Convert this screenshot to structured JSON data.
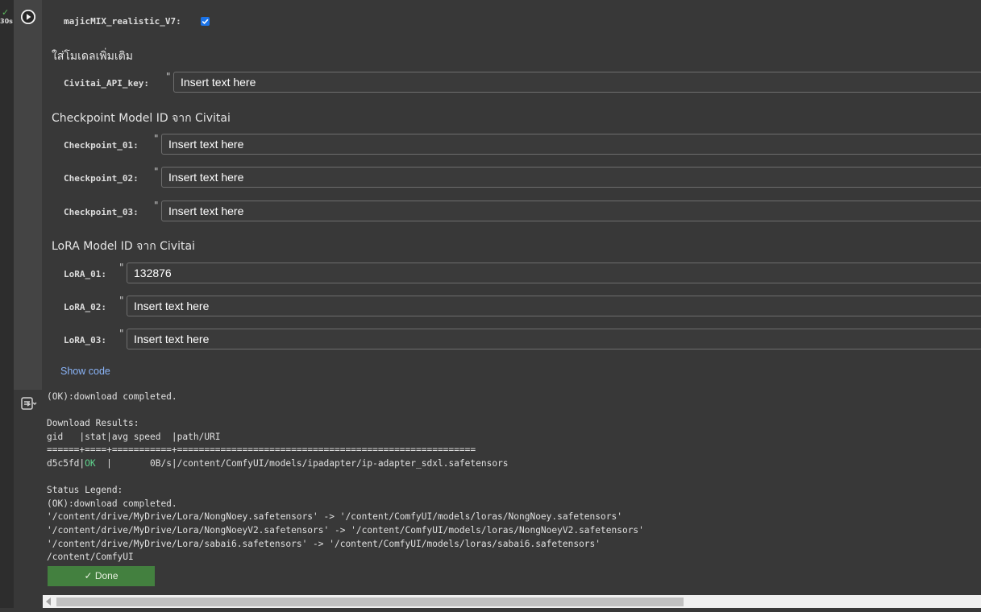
{
  "cell": {
    "runtime": "30s",
    "status_icon": "check-icon",
    "run_icon": "play-icon",
    "checkbox_field": {
      "label": "majicMIX_realistic_V7:",
      "checked": true
    },
    "section_extra": "ใส่โมเดลเพิ่มเติม",
    "api_key": {
      "label": "Civitai_API_key:",
      "value": "Insert text here"
    },
    "section_checkpoint": "Checkpoint Model ID จาก Civitai",
    "checkpoints": [
      {
        "label": "Checkpoint_01:",
        "value": "Insert text here"
      },
      {
        "label": "Checkpoint_02:",
        "value": "Insert text here"
      },
      {
        "label": "Checkpoint_03:",
        "value": "Insert text here"
      }
    ],
    "section_lora": "LoRA Model ID จาก Civitai",
    "loras": [
      {
        "label": "LoRA_01:",
        "value": "132876"
      },
      {
        "label": "LoRA_02:",
        "value": "Insert text here"
      },
      {
        "label": "LoRA_03:",
        "value": "Insert text here"
      }
    ],
    "quote_mark": "\"",
    "show_code": "Show code"
  },
  "output": {
    "line1": "(OK):download completed.",
    "line2": "",
    "line3": "Download Results:",
    "line4": "gid   |stat|avg speed  |path/URI",
    "line5": "======+====+===========+=======================================================",
    "line6_gid": "d5c5fd|",
    "line6_stat": "OK",
    "line6_rest": "  |       0B/s|/content/ComfyUI/models/ipadapter/ip-adapter_sdxl.safetensors",
    "line7": "",
    "line8": "Status Legend:",
    "line9": "(OK):download completed.",
    "line10": "'/content/drive/MyDrive/Lora/NongNoey.safetensors' -> '/content/ComfyUI/models/loras/NongNoey.safetensors'",
    "line11": "'/content/drive/MyDrive/Lora/NongNoeyV2.safetensors' -> '/content/ComfyUI/models/loras/NongNoeyV2.safetensors'",
    "line12": "'/content/drive/MyDrive/Lora/sabai6.safetensors' -> '/content/ComfyUI/models/loras/sabai6.safetensors'",
    "line13": "/content/ComfyUI",
    "done_label": "✓ Done"
  },
  "colors": {
    "ok": "#5fd38d",
    "done_bg": "#43803f",
    "link": "#8ab4f8",
    "checkbox": "#1a73e8"
  }
}
